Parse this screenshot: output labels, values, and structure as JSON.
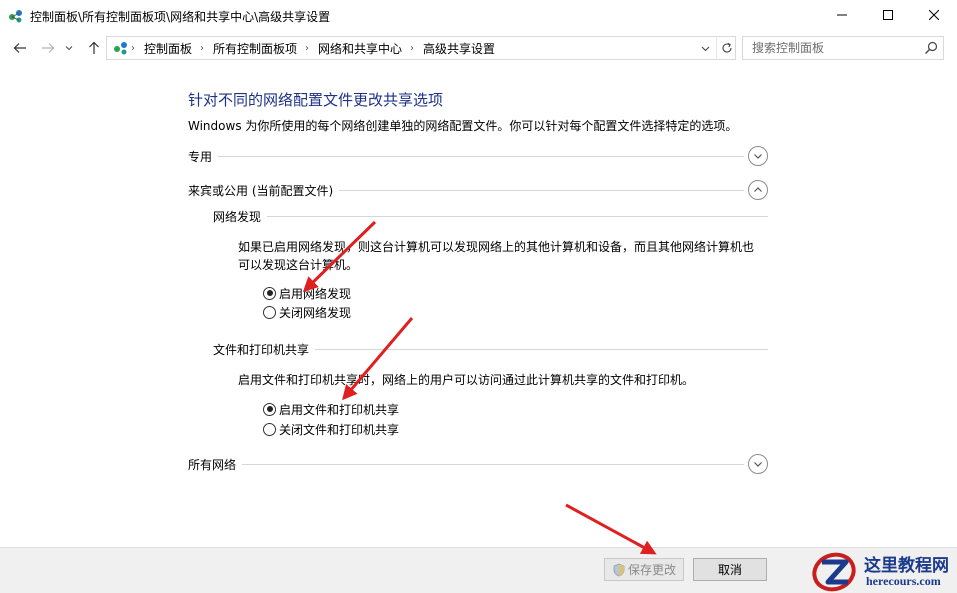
{
  "window": {
    "title": "控制面板\\所有控制面板项\\网络和共享中心\\高级共享设置",
    "minimize_glyph": "—",
    "maximize_glyph": "☐",
    "close_glyph": "✕"
  },
  "address_bar": {
    "breadcrumbs": [
      "控制面板",
      "所有控制面板项",
      "网络和共享中心",
      "高级共享设置"
    ],
    "separator": "›"
  },
  "search": {
    "placeholder": "搜索控制面板"
  },
  "page": {
    "heading": "针对不同的网络配置文件更改共享选项",
    "description": "Windows 为你所使用的每个网络创建单独的网络配置文件。你可以针对每个配置文件选择特定的选项。"
  },
  "profiles": {
    "private": {
      "label": "专用",
      "expanded": false
    },
    "guest_public": {
      "label": "来宾或公用 (当前配置文件)",
      "expanded": true,
      "network_discovery": {
        "title": "网络发现",
        "text_line1": "如果已启用网络发现，则这台计算机可以发现网络上的其他计算机和设备，而且其他网络计算机也",
        "text_line2": "可以发现这台计算机。",
        "on_label": "启用网络发现",
        "off_label": "关闭网络发现",
        "selected": "on"
      },
      "file_printer_sharing": {
        "title": "文件和打印机共享",
        "text": "启用文件和打印机共享时，网络上的用户可以访问通过此计算机共享的文件和打印机。",
        "on_label": "启用文件和打印机共享",
        "off_label": "关闭文件和打印机共享",
        "selected": "on"
      }
    },
    "all_networks": {
      "label": "所有网络",
      "expanded": false
    }
  },
  "footer": {
    "save_label": "保存更改",
    "save_enabled": false,
    "cancel_label": "取消"
  },
  "watermark": {
    "name": "这里教程网",
    "url": "herecours.com"
  },
  "colors": {
    "heading": "#1e3287",
    "annotation_arrow": "#e02020",
    "footer_bg": "#f0f0f0"
  }
}
